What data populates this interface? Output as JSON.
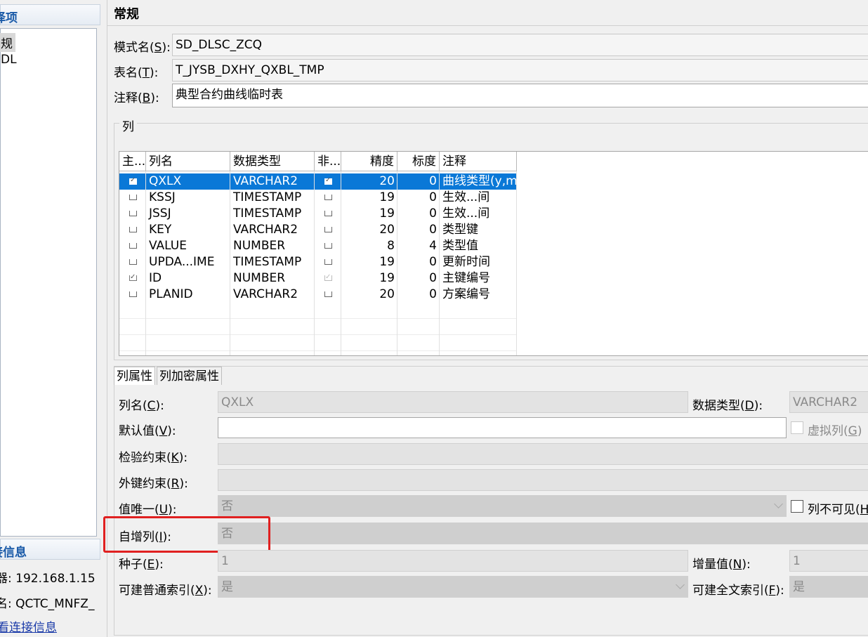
{
  "left_panel": {
    "options_header": "择项",
    "tree_items": [
      "规",
      "DL"
    ],
    "connection_header": "接信息",
    "server_line": "器: 192.168.1.15",
    "user_line": "名: QCTC_MNFZ_",
    "view_link": "看连接信息"
  },
  "section_title": "常规",
  "form": {
    "schema_label": "模式名(S):",
    "schema_value": "SD_DLSC_ZCQ",
    "table_label": "表名(T):",
    "table_value": "T_JYSB_DXHY_QXBL_TMP",
    "comment_label": "注释(B):",
    "comment_value": "典型合约曲线临时表"
  },
  "columns_group_label": "列",
  "table": {
    "headers": [
      "主...",
      "列名",
      "数据类型",
      "非...",
      "精度",
      "标度",
      "注释"
    ],
    "rows": [
      {
        "pk": true,
        "name": "QXLX",
        "type": "VARCHAR2",
        "notnull": true,
        "precision": "20",
        "scale": "0",
        "comment": "曲线类型(y,m",
        "selected": true
      },
      {
        "pk": false,
        "name": "KSSJ",
        "type": "TIMESTAMP",
        "notnull": false,
        "precision": "19",
        "scale": "0",
        "comment": "生效...间"
      },
      {
        "pk": false,
        "name": "JSSJ",
        "type": "TIMESTAMP",
        "notnull": false,
        "precision": "19",
        "scale": "0",
        "comment": "生效...间"
      },
      {
        "pk": false,
        "name": "KEY",
        "type": "VARCHAR2",
        "notnull": false,
        "precision": "20",
        "scale": "0",
        "comment": "类型键"
      },
      {
        "pk": false,
        "name": "VALUE",
        "type": "NUMBER",
        "notnull": false,
        "precision": "8",
        "scale": "4",
        "comment": "类型值"
      },
      {
        "pk": false,
        "name": "UPDA...IME",
        "type": "TIMESTAMP",
        "notnull": false,
        "precision": "19",
        "scale": "0",
        "comment": "更新时间"
      },
      {
        "pk": true,
        "name": "ID",
        "type": "NUMBER",
        "notnull": true,
        "precision": "19",
        "scale": "0",
        "comment": "主键编号"
      },
      {
        "pk": false,
        "name": "PLANID",
        "type": "VARCHAR2",
        "notnull": false,
        "precision": "20",
        "scale": "0",
        "comment": "方案编号"
      }
    ]
  },
  "tabs": [
    "列属性",
    "列加密属性"
  ],
  "props": {
    "colname_label": "列名(C):",
    "colname_value": "QXLX",
    "datatype_label": "数据类型(D):",
    "datatype_value": "VARCHAR2",
    "default_label": "默认值(V):",
    "default_value": "",
    "virtual_label": "虚拟列(G)",
    "check_label": "检验约束(K):",
    "fk_label": "外键约束(R):",
    "unique_label": "值唯一(U):",
    "unique_value": "否",
    "invisible_label": "列不可见(H",
    "identity_label": "自增列(I):",
    "identity_value": "否",
    "seed_label": "种子(E):",
    "seed_value": "1",
    "increment_label": "增量值(N):",
    "increment_value": "1",
    "index_label": "可建普通索引(X):",
    "index_value": "是",
    "fulltext_label": "可建全文索引(F):",
    "fulltext_value": "是"
  },
  "colors": {
    "selection": "#0a78d7",
    "highlight_box": "#e02020",
    "header_text": "#1a5aa8"
  }
}
